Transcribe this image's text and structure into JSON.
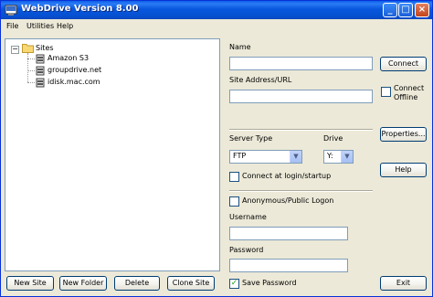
{
  "window": {
    "title": "WebDrive Version 8.00",
    "min_label": "_",
    "max_label": "□",
    "close_label": "×"
  },
  "menu": {
    "items": [
      "File",
      "Utilities",
      "Help"
    ]
  },
  "tree": {
    "toggle": "−",
    "root_label": "Sites",
    "sites": [
      "Amazon S3",
      "groupdrive.net",
      "idisk.mac.com"
    ]
  },
  "tree_buttons": {
    "new_site": "New Site",
    "new_folder": "New Folder",
    "delete": "Delete",
    "clone_site": "Clone Site"
  },
  "form": {
    "name_label": "Name",
    "name_value": "",
    "connect_button": "Connect",
    "site_address_label": "Site Address/URL",
    "site_address_value": "",
    "connect_offline_label_1": "Connect",
    "connect_offline_label_2": "Offline",
    "properties_button": "Properties...",
    "server_type_label": "Server Type",
    "server_type_value": "FTP",
    "drive_label": "Drive",
    "drive_value": "Y:",
    "help_button": "Help",
    "connect_login_label": "Connect at login/startup",
    "anonymous_label": "Anonymous/Public Logon",
    "username_label": "Username",
    "username_value": "",
    "password_label": "Password",
    "password_value": "",
    "save_password_label": "Save Password",
    "save_password_check": "✓",
    "exit_button": "Exit"
  }
}
